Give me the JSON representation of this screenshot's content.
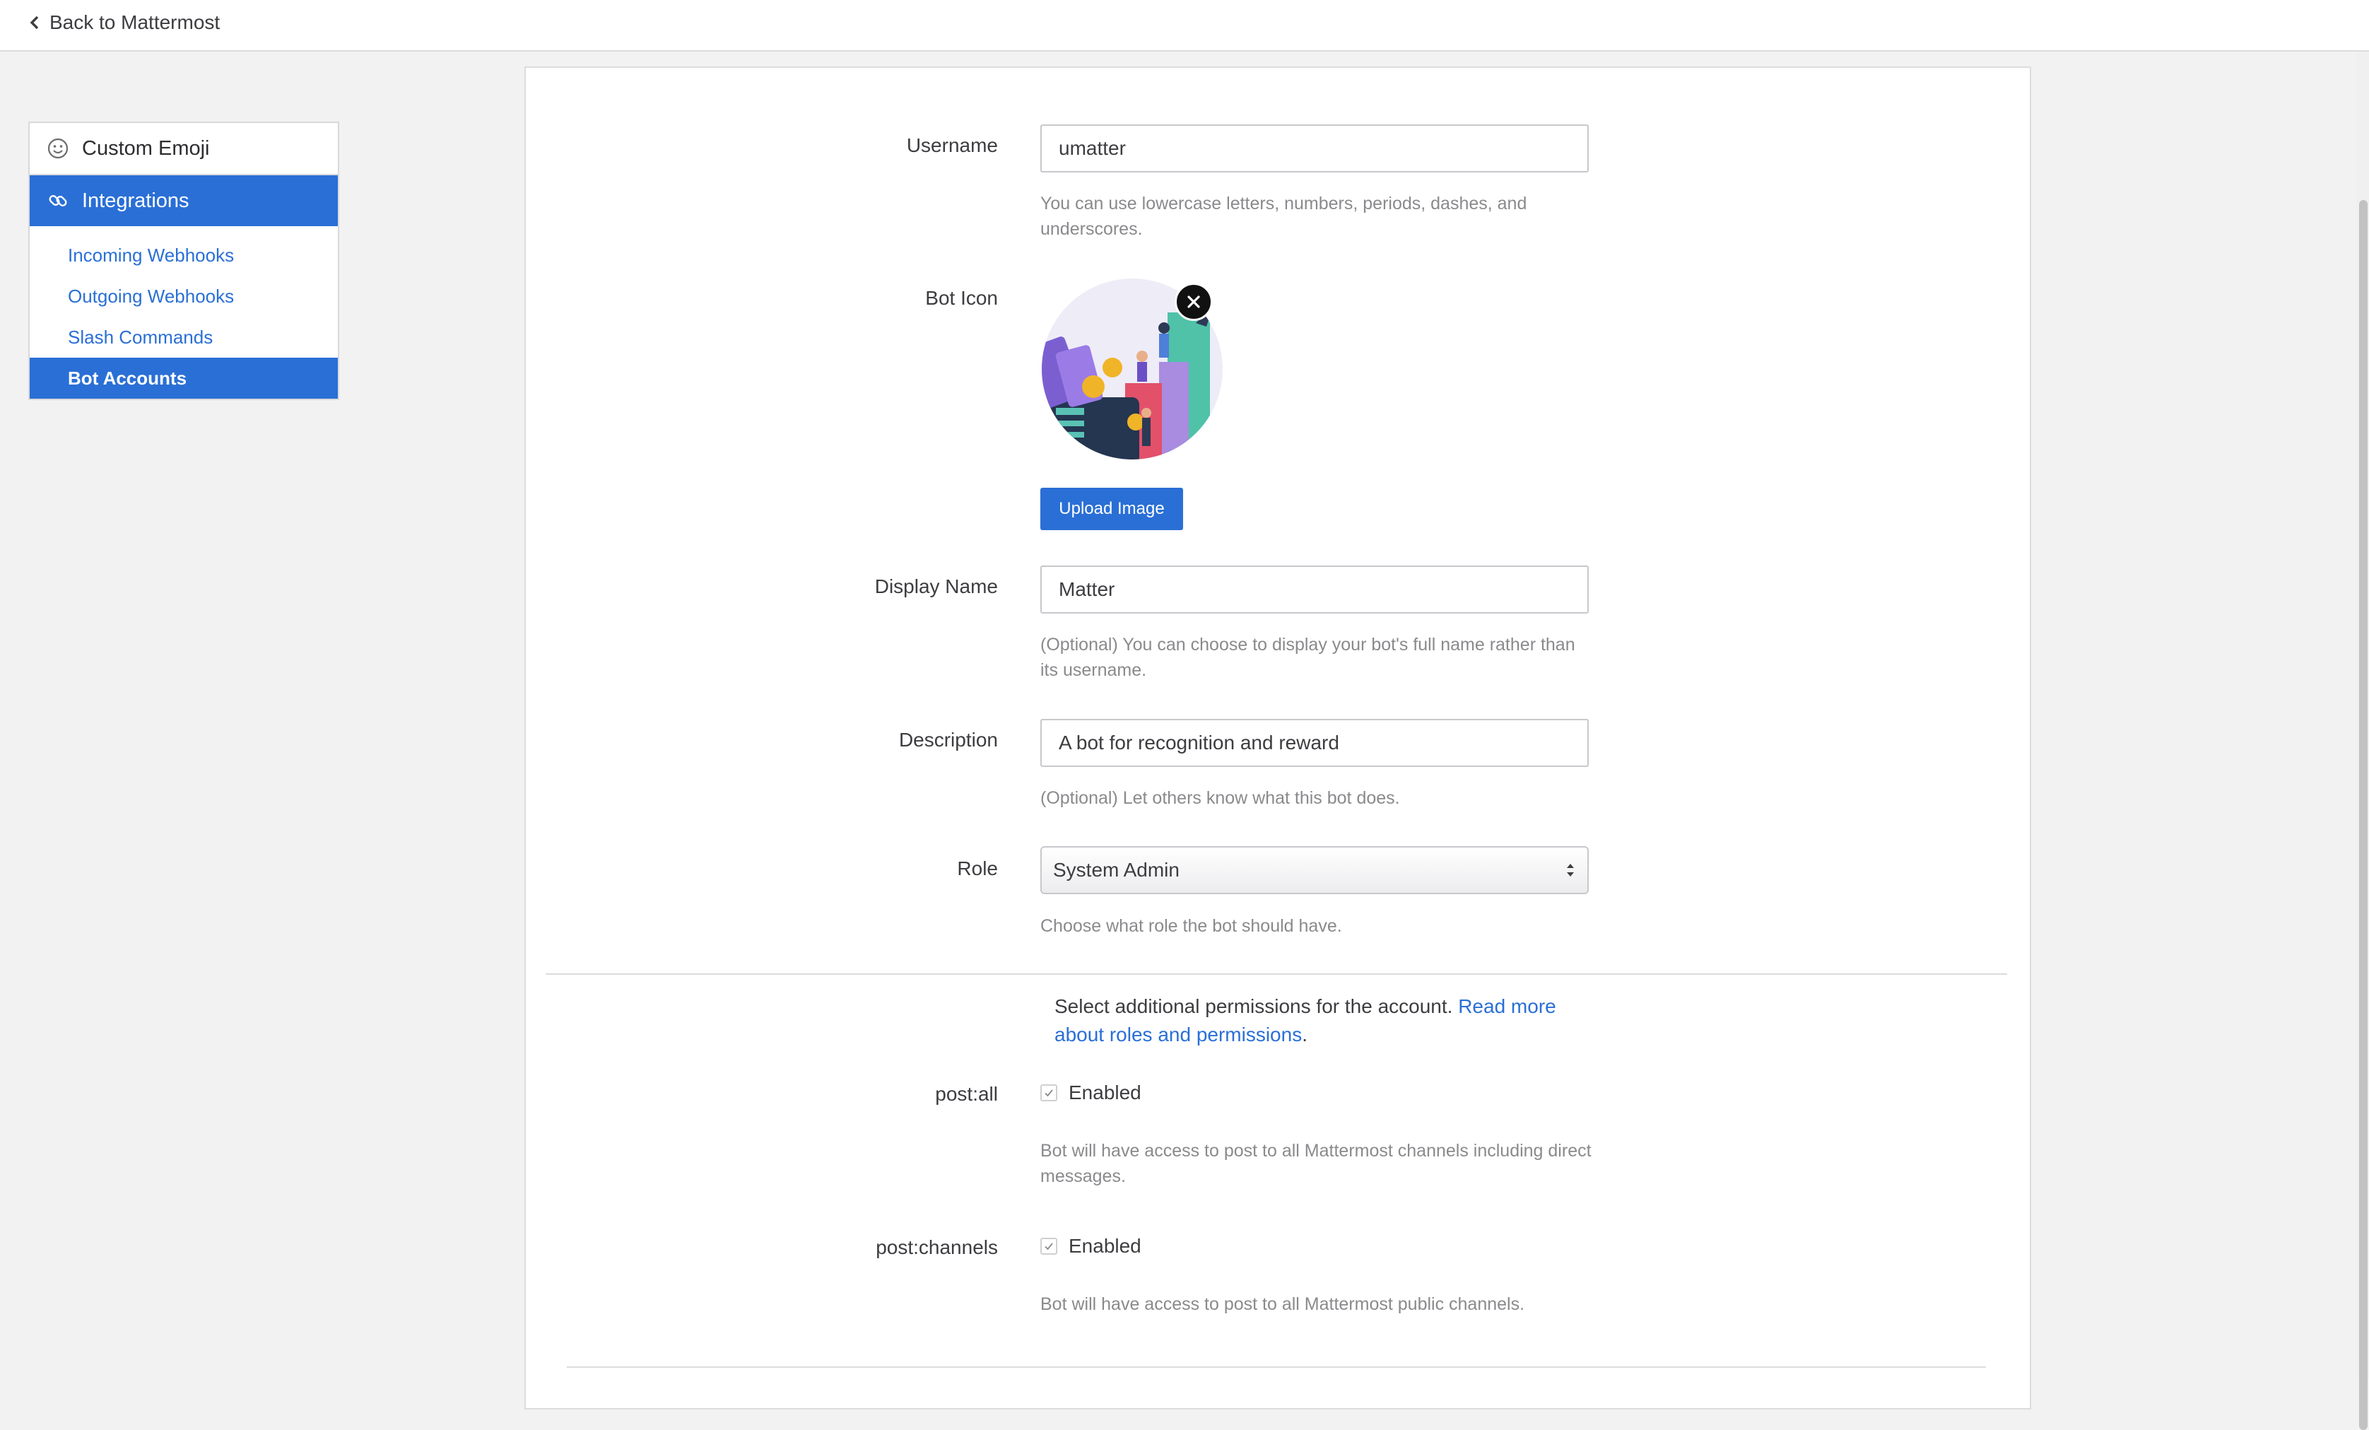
{
  "header": {
    "back_label": "Back to Mattermost"
  },
  "sidebar": {
    "sections": [
      {
        "label": "Custom Emoji",
        "icon": "smiley-icon"
      },
      {
        "label": "Integrations",
        "icon": "link-icon"
      }
    ],
    "items": [
      {
        "label": "Incoming Webhooks"
      },
      {
        "label": "Outgoing Webhooks"
      },
      {
        "label": "Slash Commands"
      },
      {
        "label": "Bot Accounts"
      }
    ]
  },
  "form": {
    "username": {
      "label": "Username",
      "value": "umatter",
      "help": "You can use lowercase letters, numbers, periods, dashes, and underscores."
    },
    "bot_icon": {
      "label": "Bot Icon",
      "upload_label": "Upload Image"
    },
    "display_name": {
      "label": "Display Name",
      "value": "Matter",
      "help": "(Optional) You can choose to display your bot's full name rather than its username."
    },
    "description": {
      "label": "Description",
      "value": "A bot for recognition and reward",
      "help": "(Optional) Let others know what this bot does."
    },
    "role": {
      "label": "Role",
      "value": "System Admin",
      "help": "Choose what role the bot should have."
    }
  },
  "permissions": {
    "intro": "Select additional permissions for the account.",
    "link": "Read more about roles and permissions",
    "link_suffix": ".",
    "post_all": {
      "label": "post:all",
      "checkbox_label": "Enabled",
      "help": "Bot will have access to post to all Mattermost channels including direct messages."
    },
    "post_channels": {
      "label": "post:channels",
      "checkbox_label": "Enabled",
      "help": "Bot will have access to post to all Mattermost public channels."
    }
  },
  "colors": {
    "accent": "#2a6fd6",
    "background": "#f2f2f3"
  }
}
